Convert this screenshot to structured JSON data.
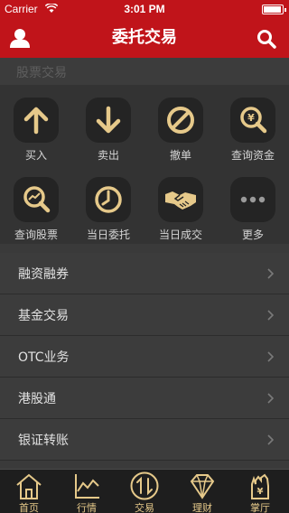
{
  "status": {
    "carrier": "Carrier",
    "time": "3:01 PM"
  },
  "nav": {
    "title": "委托交易"
  },
  "section": {
    "title": "股票交易"
  },
  "grid": [
    {
      "label": "买入",
      "icon": "arrow-up-icon"
    },
    {
      "label": "卖出",
      "icon": "arrow-down-icon"
    },
    {
      "label": "撤单",
      "icon": "cancel-icon"
    },
    {
      "label": "查询资金",
      "icon": "funds-search-icon"
    },
    {
      "label": "查询股票",
      "icon": "stock-search-icon"
    },
    {
      "label": "当日委托",
      "icon": "clock-icon"
    },
    {
      "label": "当日成交",
      "icon": "handshake-icon"
    },
    {
      "label": "更多",
      "icon": "more-icon"
    }
  ],
  "list": [
    {
      "label": "融资融券"
    },
    {
      "label": "基金交易"
    },
    {
      "label": "OTC业务"
    },
    {
      "label": "港股通"
    },
    {
      "label": "银证转账"
    }
  ],
  "tabs": [
    {
      "label": "首页",
      "icon": "home-icon"
    },
    {
      "label": "行情",
      "icon": "chart-icon"
    },
    {
      "label": "交易",
      "icon": "trade-icon",
      "active": true
    },
    {
      "label": "理财",
      "icon": "diamond-icon"
    },
    {
      "label": "掌厅",
      "icon": "hall-icon"
    }
  ],
  "colors": {
    "brand": "#c0141a",
    "gold": "#e6c98a",
    "background": "#3c3c3c"
  }
}
